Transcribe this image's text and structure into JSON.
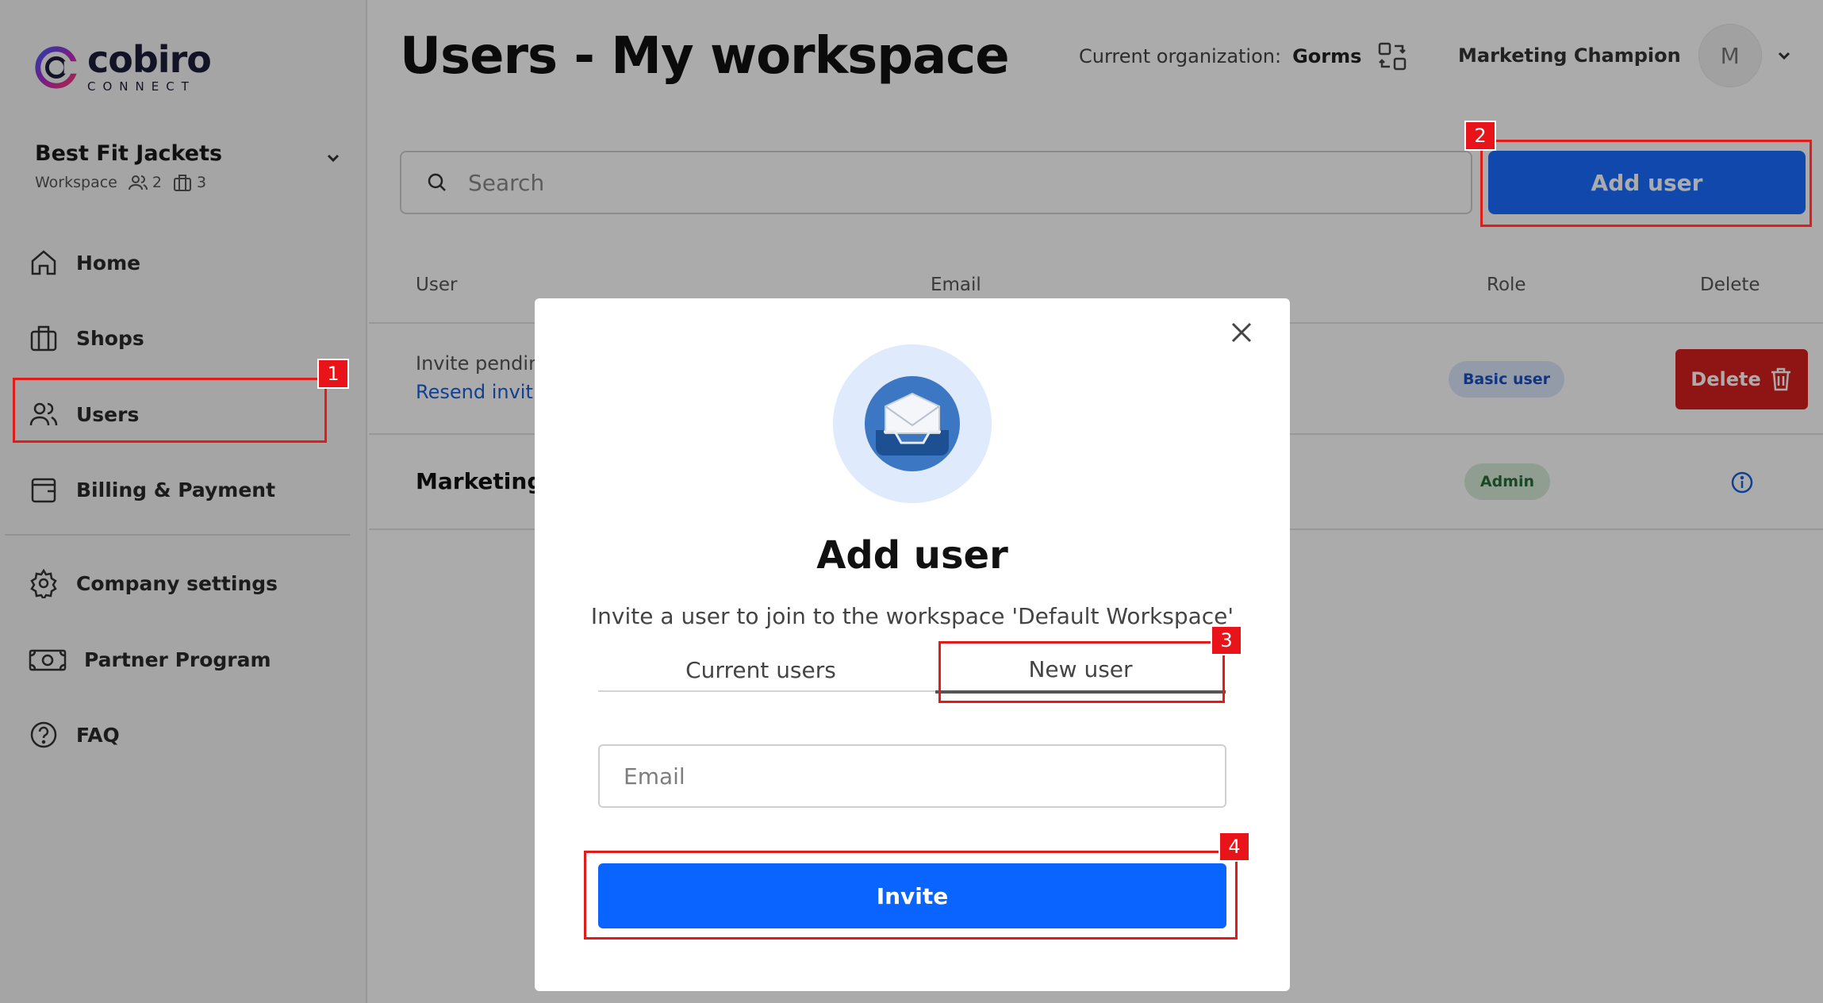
{
  "brand": {
    "name": "cobiro",
    "tagline": "CONNECT"
  },
  "workspace": {
    "name": "Best Fit Jackets",
    "type_label": "Workspace",
    "users_count": "2",
    "shops_count": "3"
  },
  "nav": {
    "items": [
      {
        "label": "Home",
        "icon": "home-icon"
      },
      {
        "label": "Shops",
        "icon": "shop-icon"
      },
      {
        "label": "Users",
        "icon": "users-icon"
      },
      {
        "label": "Billing & Payment",
        "icon": "wallet-icon"
      },
      {
        "label": "Company settings",
        "icon": "gear-icon"
      },
      {
        "label": "Partner Program",
        "icon": "money-icon"
      },
      {
        "label": "FAQ",
        "icon": "help-icon"
      }
    ]
  },
  "header": {
    "title": "Users - My workspace",
    "org_label": "Current organization:",
    "org_value": "Gorms",
    "user_name": "Marketing Champion",
    "avatar_initial": "M"
  },
  "toolbar": {
    "search_placeholder": "Search",
    "add_user_label": "Add user"
  },
  "table": {
    "headers": {
      "user": "User",
      "email": "Email",
      "role": "Role",
      "delete": "Delete"
    },
    "rows": [
      {
        "status": "Invite pendin",
        "action": "Resend invit",
        "role": "Basic user",
        "delete_label": "Delete"
      },
      {
        "user": "Marketing",
        "role": "Admin"
      }
    ]
  },
  "modal": {
    "title": "Add user",
    "subtitle": "Invite a user to join to the workspace 'Default Workspace'",
    "tabs": [
      "Current users",
      "New user"
    ],
    "active_tab": "New user",
    "email_placeholder": "Email",
    "invite_label": "Invite"
  },
  "steps": [
    "1",
    "2",
    "3",
    "4"
  ],
  "colors": {
    "primary": "#1a6cff",
    "danger": "#d61f1f",
    "highlight": "#e21b1b"
  }
}
